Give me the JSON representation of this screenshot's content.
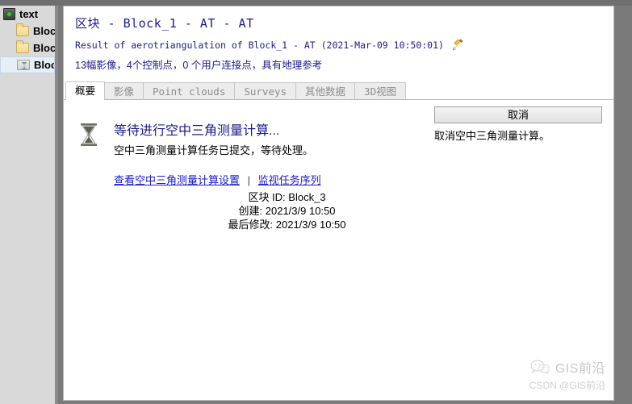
{
  "sidebar": {
    "items": [
      {
        "label": "text",
        "icon": "project-icon",
        "type": "root",
        "selected": false
      },
      {
        "label": "Bloc",
        "icon": "folder-icon",
        "type": "child",
        "selected": false
      },
      {
        "label": "Bloc",
        "icon": "folder-icon",
        "type": "child",
        "selected": false
      },
      {
        "label": "Bloc",
        "icon": "folder-hourglass-icon",
        "type": "child",
        "selected": true
      }
    ]
  },
  "header": {
    "title": "区块 - Block_1 - AT - AT",
    "subtitle": "Result of aerotriangulation of Block_1 - AT (2021-Mar-09 10:50:01)",
    "edit_icon": "pencil-icon",
    "stats": "13幅影像，4个控制点，0 个用户连接点，具有地理参考"
  },
  "tabs": [
    {
      "label": "概要",
      "active": true
    },
    {
      "label": "影像",
      "active": false
    },
    {
      "label": "Point clouds",
      "active": false
    },
    {
      "label": "Surveys",
      "active": false
    },
    {
      "label": "其他数据",
      "active": false
    },
    {
      "label": "3D视图",
      "active": false
    }
  ],
  "status": {
    "icon": "hourglass-icon",
    "title": "等待进行空中三角测量计算...",
    "description": "空中三角测量计算任务已提交，等待处理。",
    "links": [
      {
        "label": "查看空中三角测量计算设置"
      },
      {
        "label": "监视任务序列"
      }
    ],
    "link_separator": "|"
  },
  "cancel_panel": {
    "button_label": "取消",
    "description": "取消空中三角测量计算。"
  },
  "metadata": [
    {
      "key": "区块 ID:",
      "value": "Block_3"
    },
    {
      "key": "创建:",
      "value": "2021/3/9 10:50"
    },
    {
      "key": "最后修改:",
      "value": "2021/3/9 10:50"
    }
  ],
  "watermark": {
    "icon": "wechat-icon",
    "title": "GIS前沿",
    "subtitle": "CSDN @GIS前沿"
  },
  "colors": {
    "title_blue": "#1b1b8f",
    "link_blue": "#1b1bcf",
    "sidebar_bg": "#d9d9d9",
    "window_bg": "#7a7a7a",
    "selection_bg": "#e8eef7"
  }
}
